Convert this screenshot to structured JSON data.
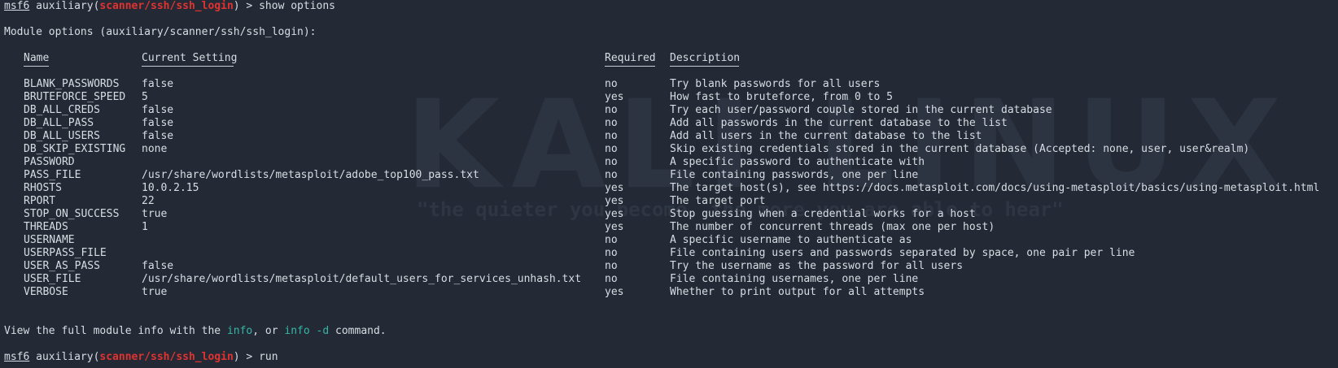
{
  "prompt1": {
    "msf": "msf6",
    "prefix": " auxiliary(",
    "module": "scanner/ssh/ssh_login",
    "suffix": ") > ",
    "command": "show options"
  },
  "module_options_title": "Module options (auxiliary/scanner/ssh/ssh_login):",
  "table": {
    "headers": {
      "name": "Name",
      "current_setting": "Current Setting",
      "required": "Required",
      "description": "Description"
    },
    "rows": [
      {
        "name": "BLANK_PASSWORDS",
        "current": "false",
        "required": "no",
        "description": "Try blank passwords for all users"
      },
      {
        "name": "BRUTEFORCE_SPEED",
        "current": "5",
        "required": "yes",
        "description": "How fast to bruteforce, from 0 to 5"
      },
      {
        "name": "DB_ALL_CREDS",
        "current": "false",
        "required": "no",
        "description": "Try each user/password couple stored in the current database"
      },
      {
        "name": "DB_ALL_PASS",
        "current": "false",
        "required": "no",
        "description": "Add all passwords in the current database to the list"
      },
      {
        "name": "DB_ALL_USERS",
        "current": "false",
        "required": "no",
        "description": "Add all users in the current database to the list"
      },
      {
        "name": "DB_SKIP_EXISTING",
        "current": "none",
        "required": "no",
        "description": "Skip existing credentials stored in the current database (Accepted: none, user, user&realm)"
      },
      {
        "name": "PASSWORD",
        "current": "",
        "required": "no",
        "description": "A specific password to authenticate with"
      },
      {
        "name": "PASS_FILE",
        "current": "/usr/share/wordlists/metasploit/adobe_top100_pass.txt",
        "required": "no",
        "description": "File containing passwords, one per line"
      },
      {
        "name": "RHOSTS",
        "current": "10.0.2.15",
        "required": "yes",
        "description": "The target host(s), see https://docs.metasploit.com/docs/using-metasploit/basics/using-metasploit.html"
      },
      {
        "name": "RPORT",
        "current": "22",
        "required": "yes",
        "description": "The target port"
      },
      {
        "name": "STOP_ON_SUCCESS",
        "current": "true",
        "required": "yes",
        "description": "Stop guessing when a credential works for a host"
      },
      {
        "name": "THREADS",
        "current": "1",
        "required": "yes",
        "description": "The number of concurrent threads (max one per host)"
      },
      {
        "name": "USERNAME",
        "current": "",
        "required": "no",
        "description": "A specific username to authenticate as"
      },
      {
        "name": "USERPASS_FILE",
        "current": "",
        "required": "no",
        "description": "File containing users and passwords separated by space, one pair per line"
      },
      {
        "name": "USER_AS_PASS",
        "current": "false",
        "required": "no",
        "description": "Try the username as the password for all users"
      },
      {
        "name": "USER_FILE",
        "current": "/usr/share/wordlists/metasploit/default_users_for_services_unhash.txt",
        "required": "no",
        "description": "File containing usernames, one per line"
      },
      {
        "name": "VERBOSE",
        "current": "true",
        "required": "yes",
        "description": "Whether to print output for all attempts"
      }
    ]
  },
  "footer": {
    "part1": "View the full module info with the ",
    "info": "info",
    "part2": ", or ",
    "info_d": "info -d",
    "part3": " command."
  },
  "prompt2": {
    "msf": "msf6",
    "prefix": " auxiliary(",
    "module": "scanner/ssh/ssh_login",
    "suffix": ") > ",
    "command": "run"
  },
  "watermark": {
    "logo": "KALI LINUX",
    "tagline": "\"the quieter you become, the more you are able to hear\""
  },
  "colors": {
    "background": "#242a35",
    "text": "#d8dde4",
    "module_red": "#e0332f",
    "info_teal": "#35b6a8"
  }
}
